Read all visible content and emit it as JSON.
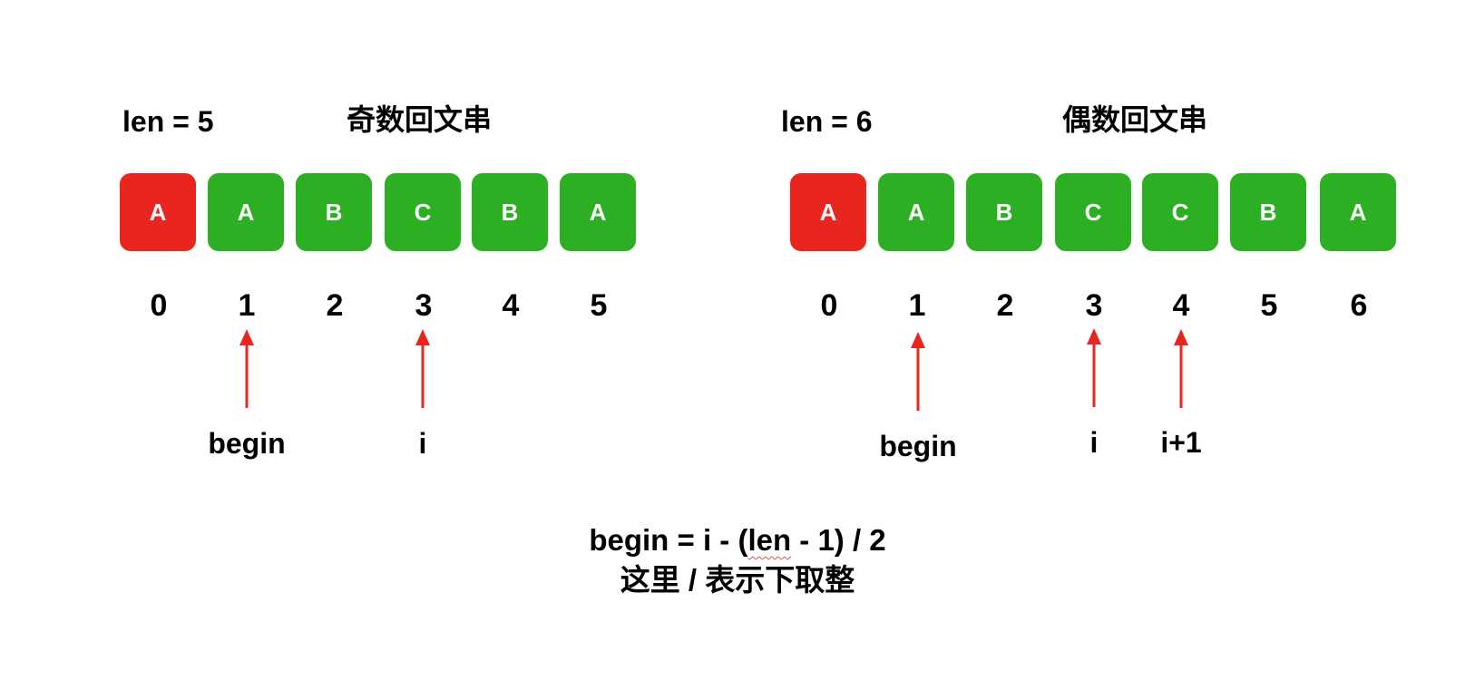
{
  "odd": {
    "len_label": "len = 5",
    "title": "奇数回文串",
    "cells": [
      "A",
      "A",
      "B",
      "C",
      "B",
      "A"
    ],
    "highlight_index": 0,
    "indices": [
      "0",
      "1",
      "2",
      "3",
      "4",
      "5"
    ],
    "pointers": [
      {
        "label": "begin",
        "index": 1
      },
      {
        "label": "i",
        "index": 3
      }
    ]
  },
  "even": {
    "len_label": "len = 6",
    "title": "偶数回文串",
    "cells": [
      "A",
      "A",
      "B",
      "C",
      "C",
      "B",
      "A"
    ],
    "highlight_index": 0,
    "indices": [
      "0",
      "1",
      "2",
      "3",
      "4",
      "5",
      "6"
    ],
    "pointers": [
      {
        "label": "begin",
        "index": 1
      },
      {
        "label": "i",
        "index": 3
      },
      {
        "label": "i+1",
        "index": 4
      }
    ]
  },
  "formula": {
    "before": "begin = i - (",
    "squiggle": "len",
    "after": " - 1) / 2",
    "note": "这里 / 表示下取整"
  },
  "colors": {
    "highlight": "#e9251f",
    "cell": "#2caf22",
    "arrow": "#e9251f",
    "cell_text": "#ffffff"
  }
}
